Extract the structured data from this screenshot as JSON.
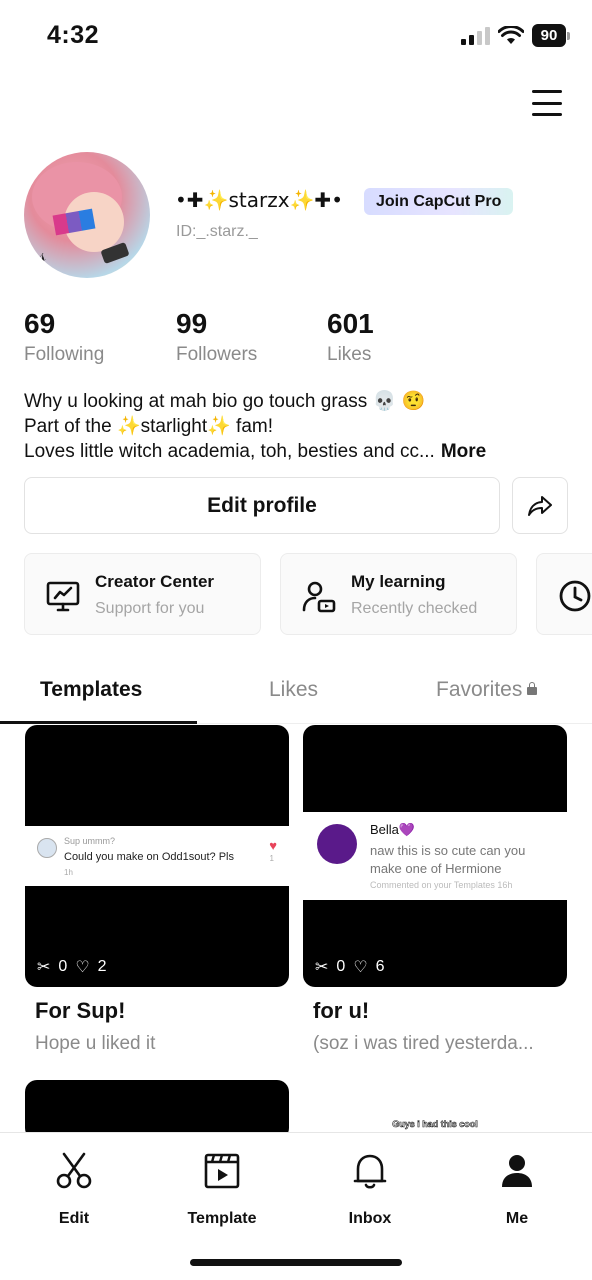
{
  "status_bar": {
    "time": "4:32",
    "battery": "90"
  },
  "profile": {
    "username": "•✚✨starzx✨✚•",
    "pro_badge": "Join CapCut Pro",
    "id": "ID:_.starz._"
  },
  "stats": [
    {
      "value": "69",
      "label": "Following"
    },
    {
      "value": "99",
      "label": "Followers"
    },
    {
      "value": "601",
      "label": "Likes"
    }
  ],
  "bio": {
    "line1": "Why u looking at mah bio go touch grass 💀 🤨",
    "line2": "Part of the ✨starlight✨ fam!",
    "line3": "Loves little witch academia, toh, besties and cc...",
    "more": "More"
  },
  "buttons": {
    "edit_profile": "Edit profile"
  },
  "cards": [
    {
      "title": "Creator Center",
      "subtitle": "Support for you"
    },
    {
      "title": "My learning",
      "subtitle": "Recently checked"
    }
  ],
  "tabs": [
    "Templates",
    "Likes",
    "Favorites"
  ],
  "templates": [
    {
      "title": "For Sup!",
      "subtitle": "Hope u liked it",
      "uses": "0",
      "likes": "2",
      "comment": {
        "name": "Sup ummm?",
        "text": "Could you make on Odd1sout? Pls",
        "time": "1h",
        "count": "1"
      }
    },
    {
      "title": "for u!",
      "subtitle": "(soz i was tired yesterda...",
      "uses": "0",
      "likes": "6",
      "comment": {
        "name": "Bella💜",
        "text": "naw this is so cute can you make one of Hermione",
        "meta": "Commented on your Templates 16h"
      }
    },
    {
      "overlay_text": "Guys i had this cool"
    }
  ],
  "bottom_nav": [
    "Edit",
    "Template",
    "Inbox",
    "Me"
  ]
}
